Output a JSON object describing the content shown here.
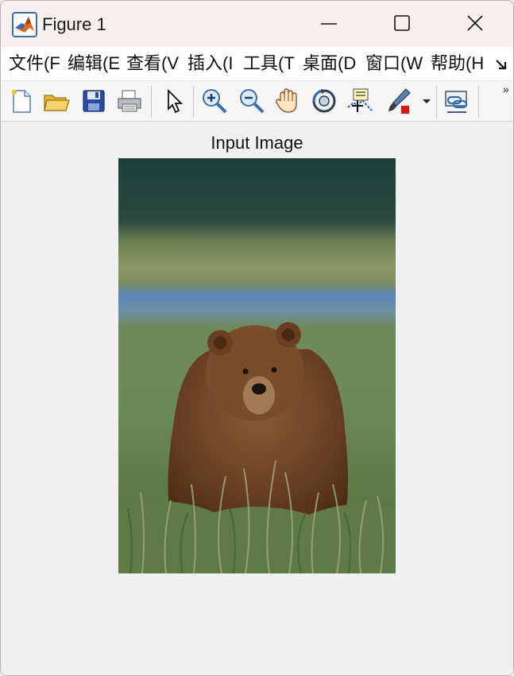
{
  "window": {
    "title": "Figure 1",
    "icon": "matlab-icon",
    "controls": [
      "minimize-icon",
      "maximize-icon",
      "close-icon"
    ]
  },
  "menubar": {
    "items": [
      {
        "label": "文件(F"
      },
      {
        "label": "编辑(E"
      },
      {
        "label": "查看(V"
      },
      {
        "label": "插入(I"
      },
      {
        "label": "工具(T"
      },
      {
        "label": "桌面(D"
      },
      {
        "label": "窗口(W"
      },
      {
        "label": "帮助(H"
      }
    ],
    "overflow_icon": "menu-overflow-arrow-icon"
  },
  "toolbar": {
    "items": [
      {
        "icon": "new-figure-icon"
      },
      {
        "icon": "open-file-icon"
      },
      {
        "icon": "save-icon"
      },
      {
        "icon": "print-icon"
      },
      {
        "icon": "select-pointer-icon"
      },
      {
        "icon": "zoom-in-icon"
      },
      {
        "icon": "zoom-out-icon"
      },
      {
        "icon": "pan-hand-icon"
      },
      {
        "icon": "rotate-3d-icon"
      },
      {
        "icon": "data-cursor-icon"
      },
      {
        "icon": "brush-icon"
      },
      {
        "icon": "dropdown-arrow-icon"
      },
      {
        "icon": "link-plot-icon"
      }
    ],
    "overflow_label": "»"
  },
  "figure": {
    "axes_title": "Input Image",
    "image_subject": "brown bear sitting in grass"
  },
  "colors": {
    "titlebar": "#f7eeee",
    "menubar": "#ffffff",
    "toolbar": "#f5f5f5",
    "figure_bg": "#f0f0f0"
  }
}
